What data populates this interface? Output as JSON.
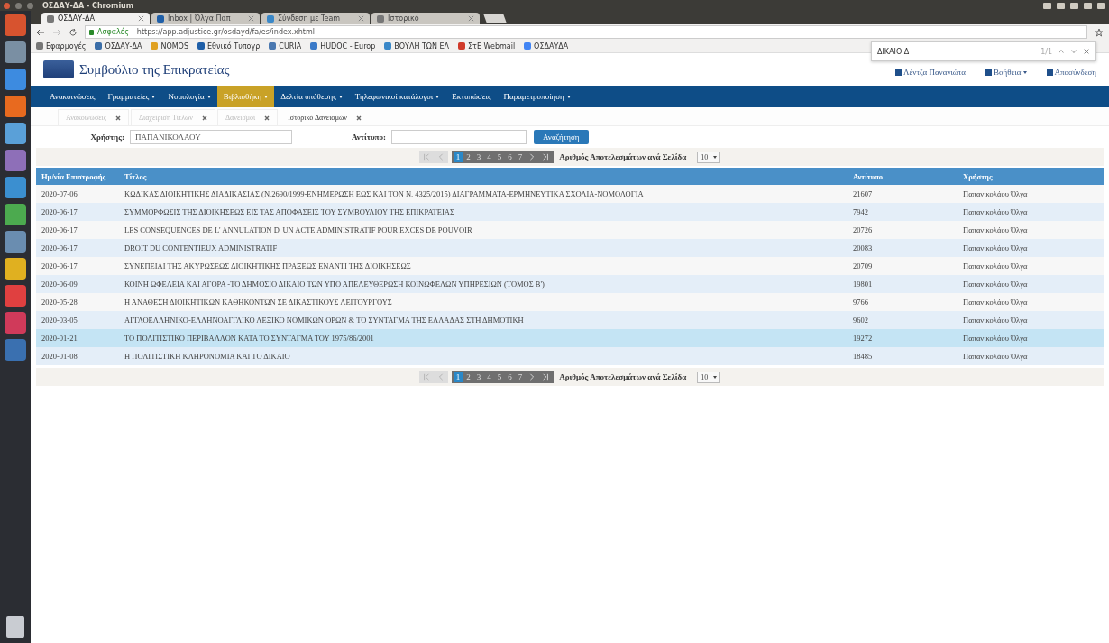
{
  "panel": {
    "title": "ΟΣΔΑΥ-ΔΑ - Chromium"
  },
  "browser_tabs": [
    {
      "label": "ΟΣΔΑΥ-ΔΑ",
      "selected": true
    },
    {
      "label": "Inbox | Όλγα Παπ",
      "selected": false
    },
    {
      "label": "Σύνδεση με Team",
      "selected": false
    },
    {
      "label": "Ιστορικό",
      "selected": false
    }
  ],
  "address_bar": {
    "security": "Ασφαλές",
    "url": "https://app.adjustice.gr/osdayd/fa/es/index.xhtml"
  },
  "bookmarks": [
    "Εφαρμογές",
    "ΟΣΔΑΥ-ΔΑ",
    "NOMOS",
    "Εθνικό Τυπογρ",
    "CURIA",
    "HUDOC - Europ",
    "ΒΟΥΛΗ ΤΩΝ ΕΛ",
    "ΣτΕ Webmail",
    "ΟΣΔΑΥΔΑ"
  ],
  "find_bar": {
    "query": "ΔΙΚΑΙΟ Δ",
    "count": "1/1"
  },
  "site": {
    "title": "Συμβούλιο της Επικρατείας",
    "user": "Λέντζα Παναγιώτα",
    "help": "Βοήθεια",
    "logout": "Αποσύνδεση"
  },
  "nav": [
    {
      "label": "Ανακοινώσεις",
      "dropdown": false,
      "selected": false
    },
    {
      "label": "Γραμματείες",
      "dropdown": true,
      "selected": false
    },
    {
      "label": "Νομολογία",
      "dropdown": true,
      "selected": false
    },
    {
      "label": "Βιβλιοθήκη",
      "dropdown": true,
      "selected": true
    },
    {
      "label": "Δελτία υπόθεσης",
      "dropdown": true,
      "selected": false
    },
    {
      "label": "Τηλεφωνικοί κατάλογοι",
      "dropdown": true,
      "selected": false
    },
    {
      "label": "Εκτυπώσεις",
      "dropdown": false,
      "selected": false
    },
    {
      "label": "Παραμετροποίηση",
      "dropdown": true,
      "selected": false
    }
  ],
  "page_tabs": [
    {
      "label": "Ανακοινώσεις",
      "selected": false
    },
    {
      "label": "Διαχείριση Τίτλων",
      "selected": false
    },
    {
      "label": "Δανεισμοί",
      "selected": false
    },
    {
      "label": "Ιστορικό Δανεισμών",
      "selected": true
    }
  ],
  "form": {
    "user_label": "Χρήστης:",
    "user_value": "ΠΑΠΑΝΙΚΟΛΑΟΥ",
    "copy_label": "Αντίτυπο:",
    "search_button": "Αναζήτηση"
  },
  "pagination_top": {
    "pages": [
      {
        "label": "1",
        "selected": true
      },
      {
        "label": "2",
        "selected": false
      },
      {
        "label": "3",
        "selected": false
      },
      {
        "label": "4",
        "selected": false
      },
      {
        "label": "5",
        "selected": false
      },
      {
        "label": "6",
        "selected": false
      },
      {
        "label": "7",
        "selected": false
      }
    ],
    "per_page_label": "Αριθμός Αποτελεσμάτων ανά Σελίδα",
    "per_page": "10"
  },
  "table": {
    "columns": [
      "Ημ/νία Επιστροφής",
      "Τίτλος",
      "Αντίτυπο",
      "Χρήστης"
    ],
    "rows": [
      {
        "date": "2020-07-06",
        "title": "ΚΩΔΙΚΑΣ ΔΙΟΙΚΗΤΙΚΗΣ ΔΙΑΔΙΚΑΣΙΑΣ (Ν.2690/1999-ΕΝΗΜΕΡΩΣΗ ΕΩΣ ΚΑΙ ΤΟΝ Ν. 4325/2015) ΔΙΑΓΡΑΜΜΑΤΑ-ΕΡΜΗΝΕΥΤΙΚΑ ΣΧΟΛΙΑ-ΝΟΜΟΛΟΓΙΑ",
        "copy": "21607",
        "user": "Παπανικολάου Όλγα",
        "selected": false
      },
      {
        "date": "2020-06-17",
        "title": "ΣΥΜΜΟΡΦΩΣΙΣ ΤΗΣ ΔΙΟΙΚΗΣΕΩΣ ΕΙΣ ΤΑΣ ΑΠΟΦΑΣΕΙΣ ΤΟΥ ΣΥΜΒΟΥΛΙΟΥ ΤΗΣ ΕΠΙΚΡΑΤΕΙΑΣ",
        "copy": "7942",
        "user": "Παπανικολάου Όλγα",
        "selected": false
      },
      {
        "date": "2020-06-17",
        "title": "LES CONSEQUENCES DE L' ANNULATION D' UN ACTE ADMINISTRATIF POUR EXCES DE POUVOIR",
        "copy": "20726",
        "user": "Παπανικολάου Όλγα",
        "selected": false
      },
      {
        "date": "2020-06-17",
        "title": "DROIT DU CONTENTIEUX ADMINISTRATIF",
        "copy": "20083",
        "user": "Παπανικολάου Όλγα",
        "selected": false
      },
      {
        "date": "2020-06-17",
        "title": "ΣΥΝΕΠΕΙΑΙ ΤΗΣ ΑΚΥΡΩΣΕΩΣ ΔΙΟΙΚΗΤΙΚΗΣ ΠΡΑΞΕΩΣ ΕΝΑΝΤΙ ΤΗΣ ΔΙΟΙΚΗΣΕΩΣ",
        "copy": "20709",
        "user": "Παπανικολάου Όλγα",
        "selected": false
      },
      {
        "date": "2020-06-09",
        "title": "ΚΟΙΝΗ ΩΦΕΛΕΙΑ ΚΑΙ ΑΓΟΡΑ -ΤΟ ΔΗΜΟΣΙΟ ΔΙΚΑΙΟ ΤΩΝ ΥΠΟ ΑΠΕΛΕΥΘΕΡΩΣΗ ΚΟΙΝΩΦΕΛΩΝ ΥΠΗΡΕΣΙΩΝ (ΤΟΜΟΣ Β')",
        "copy": "19801",
        "user": "Παπανικολάου Όλγα",
        "selected": false
      },
      {
        "date": "2020-05-28",
        "title": "Η ΑΝΑΘΕΣΗ ΔΙΟΙΚΗΤΙΚΩΝ ΚΑΘΗΚΟΝΤΩΝ ΣΕ ΔΙΚΑΣΤΙΚΟΥΣ ΛΕΙΤΟΥΡΓΟΥΣ",
        "copy": "9766",
        "user": "Παπανικολάου Όλγα",
        "selected": false
      },
      {
        "date": "2020-03-05",
        "title": "ΑΓΓΛΟΕΛΛΗΝΙΚΟ-ΕΛΛΗΝΟΑΓΓΛΙΚΟ ΛΕΞΙΚΟ ΝΟΜΙΚΩΝ ΟΡΩΝ & ΤΟ ΣΥΝΤΑΓΜΑ ΤΗΣ ΕΛΛΑΔΑΣ ΣΤΗ ΔΗΜΟΤΙΚΗ",
        "copy": "9602",
        "user": "Παπανικολάου Όλγα",
        "selected": false
      },
      {
        "date": "2020-01-21",
        "title": "ΤΟ ΠΟΛΙΤΙΣΤΙΚΟ ΠΕΡΙΒΑΛΛΟΝ ΚΑΤΑ ΤΟ ΣΥΝΤΑΓΜΑ ΤΟΥ 1975/86/2001",
        "copy": "19272",
        "user": "Παπανικολάου Όλγα",
        "selected": true
      },
      {
        "date": "2020-01-08",
        "title": "Η ΠΟΛΙΤΙΣΤΙΚΗ ΚΛΗΡΟΝΟΜΙΑ ΚΑΙ ΤΟ ΔΙΚΑΙΟ",
        "copy": "18485",
        "user": "Παπανικολάου Όλγα",
        "selected": false
      }
    ]
  },
  "pagination_bottom": {
    "pages": [
      {
        "label": "1",
        "selected": true
      },
      {
        "label": "2",
        "selected": false
      },
      {
        "label": "3",
        "selected": false
      },
      {
        "label": "4",
        "selected": false
      },
      {
        "label": "5",
        "selected": false
      },
      {
        "label": "6",
        "selected": false
      },
      {
        "label": "7",
        "selected": false
      }
    ],
    "per_page_label": "Αριθμός Αποτελεσμάτων ανά Σελίδα",
    "per_page": "10"
  }
}
